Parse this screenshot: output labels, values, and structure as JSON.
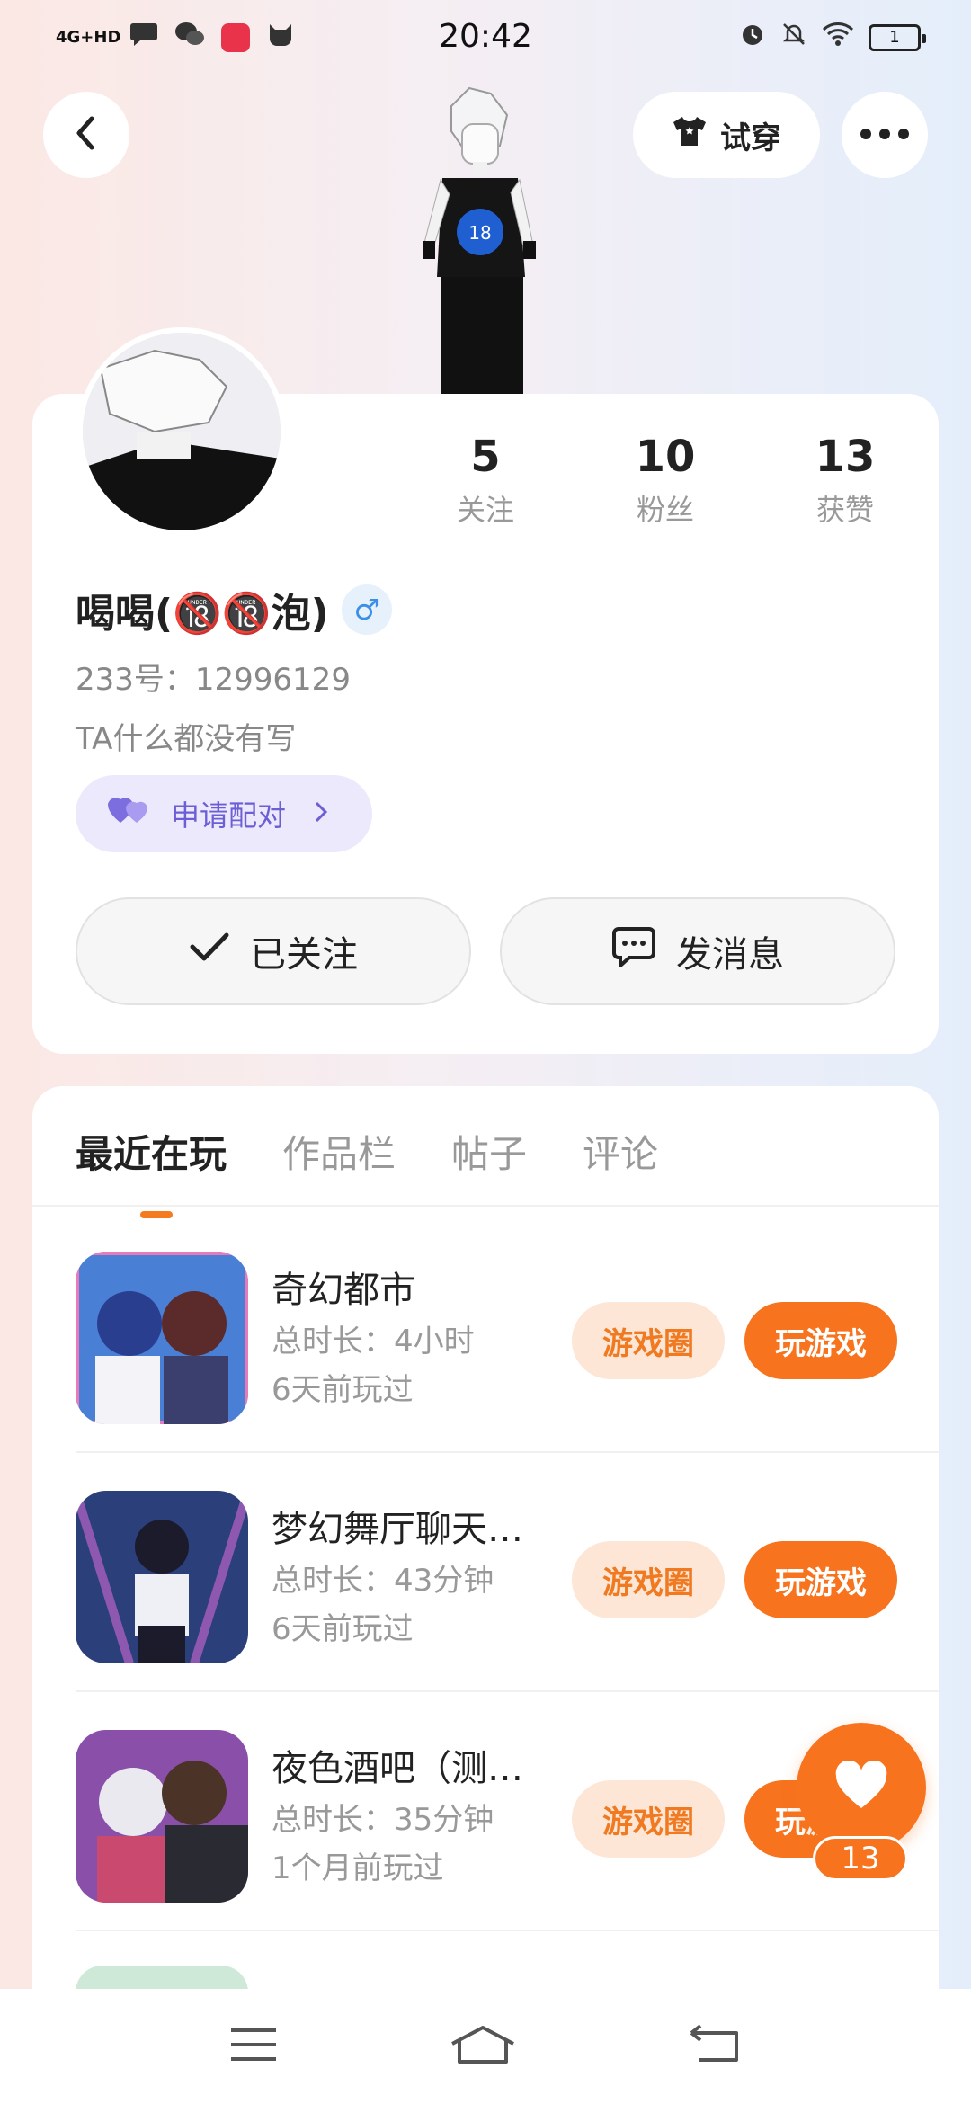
{
  "status_bar": {
    "network": "4G+HD",
    "time": "20:42",
    "battery": "1"
  },
  "header": {
    "try_on_label": "试穿"
  },
  "profile": {
    "stats": [
      {
        "value": "5",
        "label": "关注"
      },
      {
        "value": "10",
        "label": "粉丝"
      },
      {
        "value": "13",
        "label": "获赞"
      }
    ],
    "name": "喝喝(🔞🔞泡)",
    "gender_symbol": "♂",
    "uid": "233号：12996129",
    "bio": "TA什么都没有写",
    "pair_label": "申请配对",
    "follow_label": "已关注",
    "message_label": "发消息"
  },
  "tabs": [
    {
      "label": "最近在玩",
      "active": true
    },
    {
      "label": "作品栏",
      "active": false
    },
    {
      "label": "帖子",
      "active": false
    },
    {
      "label": "评论",
      "active": false
    }
  ],
  "games": [
    {
      "title": "奇幻都市",
      "duration": "总时长：4小时",
      "last_played": "6天前玩过",
      "circle_label": "游戏圈",
      "play_label": "玩游戏",
      "thumb_color": "#4a7fd6"
    },
    {
      "title": "梦幻舞厅聊天…",
      "duration": "总时长：43分钟",
      "last_played": "6天前玩过",
      "circle_label": "游戏圈",
      "play_label": "玩游戏",
      "thumb_color": "#2b3f7a"
    },
    {
      "title": "夜色酒吧（测…",
      "duration": "总时长：35分钟",
      "last_played": "1个月前玩过",
      "circle_label": "游戏圈",
      "play_label": "玩游戏",
      "thumb_color": "#8a4fa8"
    }
  ],
  "like": {
    "count": "13"
  },
  "colors": {
    "accent": "#f7731d",
    "accent_light": "#fde6d6",
    "pair_bg": "#ece9fc",
    "pair_text": "#6c5fd6"
  }
}
